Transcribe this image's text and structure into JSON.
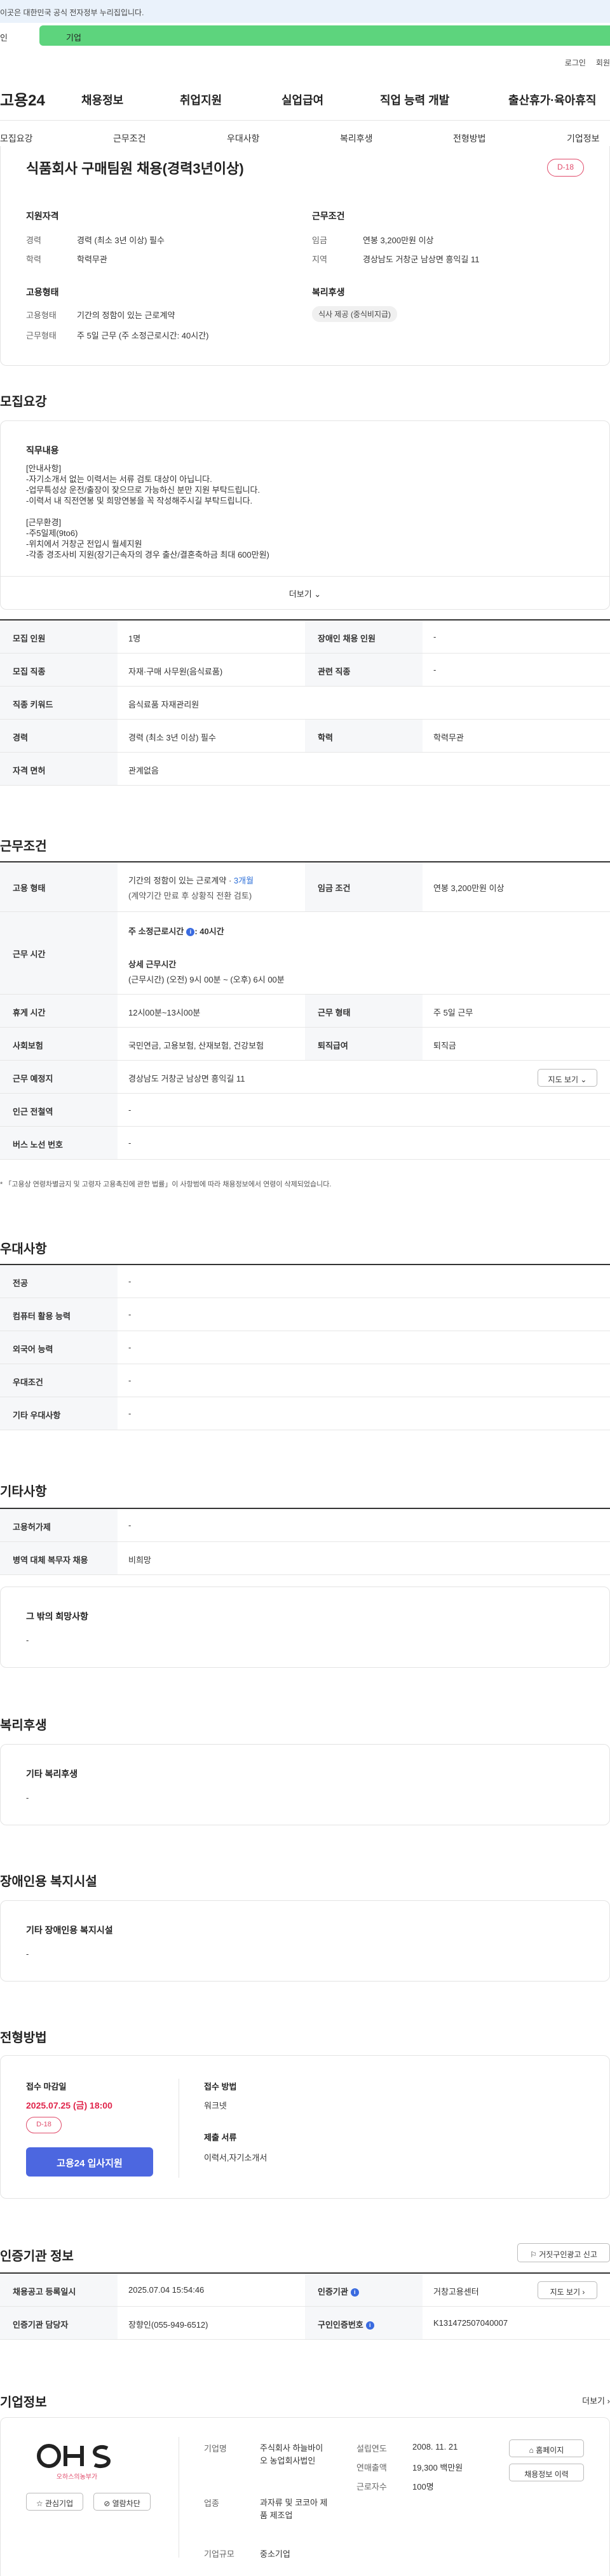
{
  "banner": {
    "text": "이곳은 대한민국 공식 전자정부 누리집입니다."
  },
  "login_bar": {
    "label": "인",
    "tab": "기업"
  },
  "toplinks": {
    "login": "로그인",
    "join": "회원"
  },
  "gnb": {
    "logo": "고용24",
    "menus": [
      "채용정보",
      "취업지원",
      "실업급여",
      "직업 능력 개발",
      "출산휴가·육아휴직"
    ]
  },
  "lnb": [
    "모집요강",
    "근무조건",
    "우대사항",
    "복리후생",
    "전형방법",
    "기업정보"
  ],
  "summary": {
    "title": "식품회사 구매팀원 채용(경력3년이상)",
    "dday": "D-18",
    "qual_title": "지원자격",
    "qual": [
      {
        "k": "경력",
        "v": "경력 (최소 3년 이상) 필수"
      },
      {
        "k": "학력",
        "v": "학력무관"
      }
    ],
    "cond_title": "근무조건",
    "cond": [
      {
        "k": "임금",
        "v": "연봉 3,200만원 이상"
      },
      {
        "k": "지역",
        "v": "경상남도 거창군 남상면 흥익길 11"
      }
    ],
    "emp_title": "고용형태",
    "emp": [
      {
        "k": "고용형태",
        "v": "기간의 정함이 있는 근로계약"
      },
      {
        "k": "근무형태",
        "v": "주 5일 근무 (주 소정근로시간: 40시간)"
      }
    ],
    "welfare_title": "복리후생",
    "welfare_chip": "식사 제공 (중식비지급)"
  },
  "recruit": {
    "section": "모집요강",
    "duty_title": "직무내용",
    "duty_text": "[안내사항]\n-자기소개서 없는 이력서는 서류 검토 대상이 아닙니다.\n-업무특성상 운전/출장이 잦으므로 가능하신 분만 지원 부탁드립니다.\n-이력서 내 직전연봉 및 희망연봉을 꼭 작성해주시길 부탁드립니다.\n\n[근무환경]\n-주5일제(9to6)\n-위치에서 거창군 전입시 월세지원\n-각종 경조사비 지원(장기근속자의 경우 출산/결혼축하금 최대 600만원)",
    "more": "더보기",
    "table": [
      [
        {
          "k": "모집 인원",
          "v": "1명"
        },
        {
          "k": "장애인 채용 인원",
          "v": "-"
        }
      ],
      [
        {
          "k": "모집 직종",
          "v": "자재·구매 사무원(음식료품)"
        },
        {
          "k": "관련 직종",
          "v": "-"
        }
      ],
      [
        {
          "k": "직종 키워드",
          "v": "음식료품 자재관리원"
        }
      ],
      [
        {
          "k": "경력",
          "v": "경력 (최소 3년 이상) 필수"
        },
        {
          "k": "학력",
          "v": "학력무관"
        }
      ],
      [
        {
          "k": "자격 면허",
          "v": "관계없음"
        }
      ]
    ]
  },
  "work": {
    "section": "근무조건",
    "emp_type_k": "고용 형태",
    "emp_type_v1": "기간의 정함이 있는 근로계약 · ",
    "emp_type_v1b": "3개월",
    "emp_type_v2": "(계약기간 만료 후 상황직 전환 검토)",
    "wage_k": "임금 조건",
    "wage_v": "연봉 3,200만원 이상",
    "hours_k": "근무 시간",
    "hours_v1": "주 소정근로시간",
    "hours_v1b": ": 40시간",
    "hours_v2": "상세 근무시간",
    "hours_v3": "(근무시간) (오전) 9시 00분 ~ (오후) 6시 00분",
    "rows": [
      [
        {
          "k": "휴게 시간",
          "v": "12시00분~13시00분"
        },
        {
          "k": "근무 형태",
          "v": "주 5일 근무"
        }
      ],
      [
        {
          "k": "사회보험",
          "v": "국민연금, 고용보험, 산재보험, 건강보험"
        },
        {
          "k": "퇴직급여",
          "v": "퇴직금"
        }
      ],
      [
        {
          "k": "근무 예정지",
          "v": "경상남도 거창군 남상면 흥익길 11"
        }
      ],
      [
        {
          "k": "인근 전철역",
          "v": "-"
        }
      ],
      [
        {
          "k": "버스 노선 번호",
          "v": "-"
        }
      ]
    ],
    "map_btn": "지도 보기",
    "note": "「고용상 연령차별금지 및 고령자 고용촉진에 관한 법률」이 사항범에 따라 채용정보에서 연령이 삭제되었습니다."
  },
  "pref": {
    "section": "우대사항",
    "rows": [
      {
        "k": "전공",
        "v": "-"
      },
      {
        "k": "컴퓨터 활용 능력",
        "v": "-"
      },
      {
        "k": "외국어 능력",
        "v": "-"
      },
      {
        "k": "우대조건",
        "v": "-"
      },
      {
        "k": "기타 우대사항",
        "v": "-"
      }
    ]
  },
  "etc": {
    "section": "기타사항",
    "rows": [
      {
        "k": "고용허가제",
        "v": "-"
      },
      {
        "k": "병역 대체 복무자 채용",
        "v": "비희망"
      }
    ],
    "box_title": "그 밖의 희망사항",
    "box_v": "-"
  },
  "welfare": {
    "section": "복리후생",
    "box_title": "기타 복리후생",
    "box_v": "-"
  },
  "disability": {
    "section": "장애인용 복지시설",
    "box_title": "기타 장애인용 복지시설",
    "box_v": "-"
  },
  "process": {
    "section": "전형방법",
    "deadline_k": "접수 마감일",
    "deadline_v": "2025.07.25 (금) 18:00",
    "dday": "D-18",
    "apply": "고용24 입사지원",
    "method_k": "접수 방법",
    "method_v": "워크넷",
    "docs_k": "제출 서류",
    "docs_v": "이력서,자기소개서"
  },
  "cert": {
    "section": "인증기관 정보",
    "report_btn": "거짓구인광고 신고",
    "rows": [
      [
        {
          "k": "채용공고 등록일시",
          "v": "2025.07.04 15:54:46"
        },
        {
          "k": "인증기관",
          "v": "거창고용센터"
        }
      ],
      [
        {
          "k": "인증기관 담당자",
          "v": "장향인(055-949-6512)"
        },
        {
          "k": "구인인증번호",
          "v": "K131472507040007"
        }
      ]
    ],
    "map_btn": "지도 보기"
  },
  "company": {
    "section": "기업정보",
    "more": "더보기",
    "logo_text": "OHS",
    "logo_sub": "오하스의농부가",
    "fav_btn": "관심기업",
    "block_btn": "열람차단",
    "items_l": [
      {
        "k": "기업명",
        "v": "주식회사 하늘바이오 농업회사법인"
      },
      {
        "k": "업종",
        "v": "과자류 및 코코아 제품 제조업"
      },
      {
        "k": "기업규모",
        "v": "중소기업"
      }
    ],
    "items_r": [
      {
        "k": "설립연도",
        "v": "2008. 11. 21"
      },
      {
        "k": "연매출액",
        "v": "19,300 백만원"
      },
      {
        "k": "근로자수",
        "v": "100명"
      }
    ],
    "home_btn": "홈페이지",
    "jobs_btn": "채용정보 이력"
  }
}
